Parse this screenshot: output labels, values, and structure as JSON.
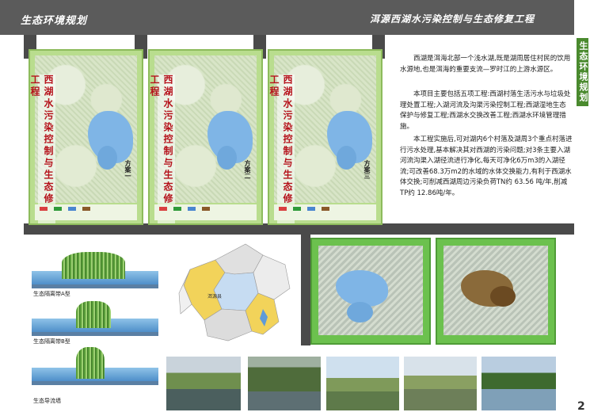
{
  "header": {
    "left_title": "生态环境规划",
    "right_title": "洱源西湖水污染控制与生态修复工程"
  },
  "side": {
    "vertical_title": "生态环境规划",
    "page_number": "2"
  },
  "maps": [
    {
      "title": "西湖水污染控制与生态修复工程",
      "tag": "方案一"
    },
    {
      "title": "西湖水污染控制与生态修复工程",
      "tag": "方案二"
    },
    {
      "title": "西湖水污染控制与生态修复工程",
      "tag": "方案三"
    }
  ],
  "text": {
    "p1": "西湖是洱海北部一个浅水湖,既是湖周居住村民的饮用水源地,也是洱海的重要支流—罗时江的上游水源区。",
    "p2": "本项目主要包括五项工程:西湖村落生活污水与垃圾处理处置工程;入湖河流及沟渠污染控制工程;西湖湿地生态保护与修复工程;西湖水交换改善工程;西湖水环境管理措施。",
    "p3": "本工程实施后,可对湖内6个村落及湖周3个重点村落进行污水处理,基本解决其对西湖的污染问题;对3条主要入湖河流沟渠入湖径流进行净化,每天可净化6万m3的入湖径流;可改善68.3万m2的水域的水体交换能力,有利于西湖水体交换;可削减西湖周边污染负荷TN约 63.56 吨/年,削减TP约 12.86吨/年。"
  },
  "diagrams": [
    {
      "label": "生态隔离带A型"
    },
    {
      "label": "生态隔离带B型"
    },
    {
      "label": "生态导流墙"
    }
  ],
  "colors": {
    "header_bg": "#5b5b5b",
    "accent_green": "#4a8a2e",
    "map_green": "#b9dd8e",
    "lake_blue": "#7fb5e6"
  }
}
